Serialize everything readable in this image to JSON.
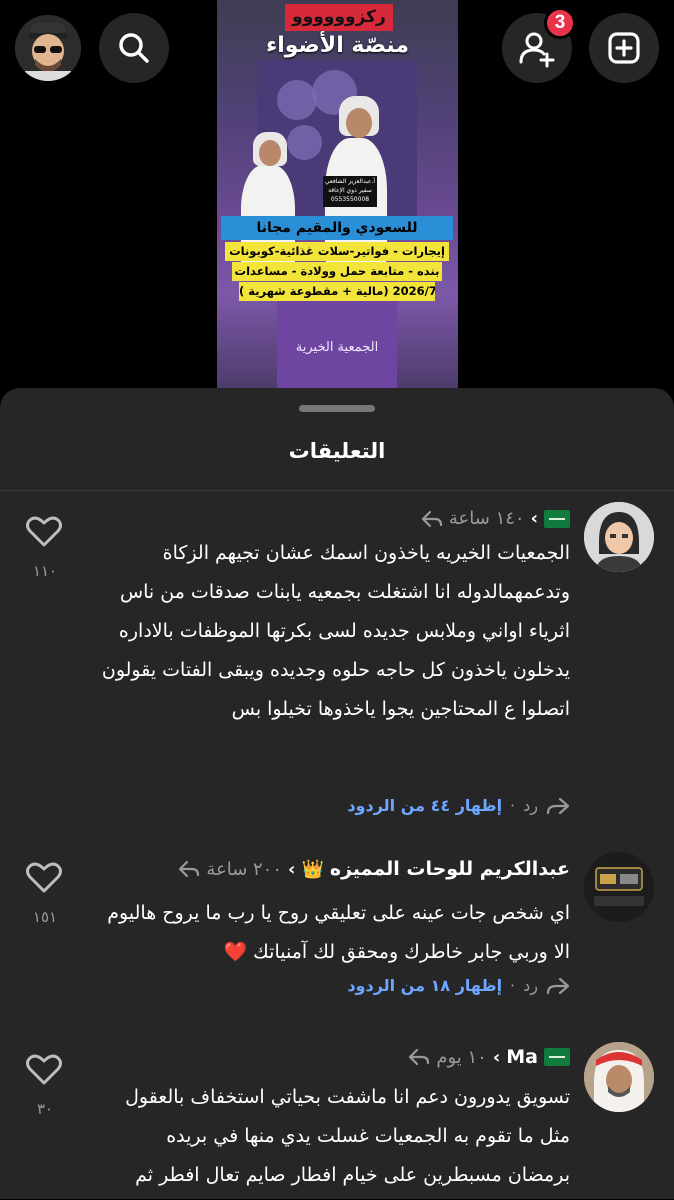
{
  "top_bar": {
    "notification_count": "3"
  },
  "story": {
    "banner_red": "ركزوووووو",
    "headline": "منصّة الأضواء",
    "namecard_line1": "أ.عبدالعزيز الشافعي",
    "namecard_line2": "سفير ذوي الإعاقة",
    "namecard_phone": "0553550008",
    "blue_bar": "للسعودي والمقيم مجانا",
    "yellow_1": "إيجارات - فواتير-سلات غذائية-كوبونات",
    "yellow_2": "بنده - متابعة حمل وولادة - مساعدات",
    "yellow_3": "( مالية + مقطوعة شهرية) 2026/7/26",
    "logo_text": "الجمعية الخيرية"
  },
  "sheet": {
    "title": "التعليقات"
  },
  "comments": [
    {
      "user": "",
      "time": "١٤٠ ساعة",
      "body": "الجمعيات الخيريه ياخذون اسمك عشان تجيهم الزكاة وتدعمهمالدوله انا اشتغلت بجمعيه يابنات صدقات من ناس اثرياء اواني وملابس جديده لسى بكرتها الموظفات بالاداره يدخلون ياخذون كل حاجه حلوه وجديده ويبقى الفتات يقولون اتصلوا ع المحتاجين يجوا ياخذوها تخيلوا بس",
      "reply": "رد",
      "dot": "·",
      "show_replies": "إظهار ٤٤ من الردود",
      "likes": "١١٠"
    },
    {
      "user": "عبدالكريم للوحات المميزه",
      "emoji": "👑",
      "time": "٢٠٠ ساعة",
      "body": "اي شخص جات عينه على تعليقي روح يا رب ما يروح هاليوم الا وربي جابر خاطرك ومحقق لك آمنياتك ❤️",
      "reply": "رد",
      "dot": "·",
      "show_replies": "إظهار ١٨ من الردود",
      "likes": "١٥١"
    },
    {
      "user": "Ma",
      "time": "١٠ يوم",
      "body": "تسويق يدورون دعم انا ماشفت بحياتي استخفاف بالعقول مثل ما تقوم به الجمعيات غسلت يدي منها في بريده برمضان مسبطرين على خيام افطار صايم تعال افطر ثم",
      "likes": "٣٠"
    }
  ],
  "colors": {
    "background": "#000000",
    "sheet": "#262626",
    "link": "#6ea6ff",
    "badge": "#e8334a",
    "muted": "#9a9a9a"
  },
  "icons": [
    "profile-avatar",
    "search-icon",
    "add-friend-icon",
    "add-post-icon",
    "reply-arrow-icon",
    "chevron-icon",
    "heart-icon",
    "saudi-flag-icon",
    "crown-emoji"
  ]
}
